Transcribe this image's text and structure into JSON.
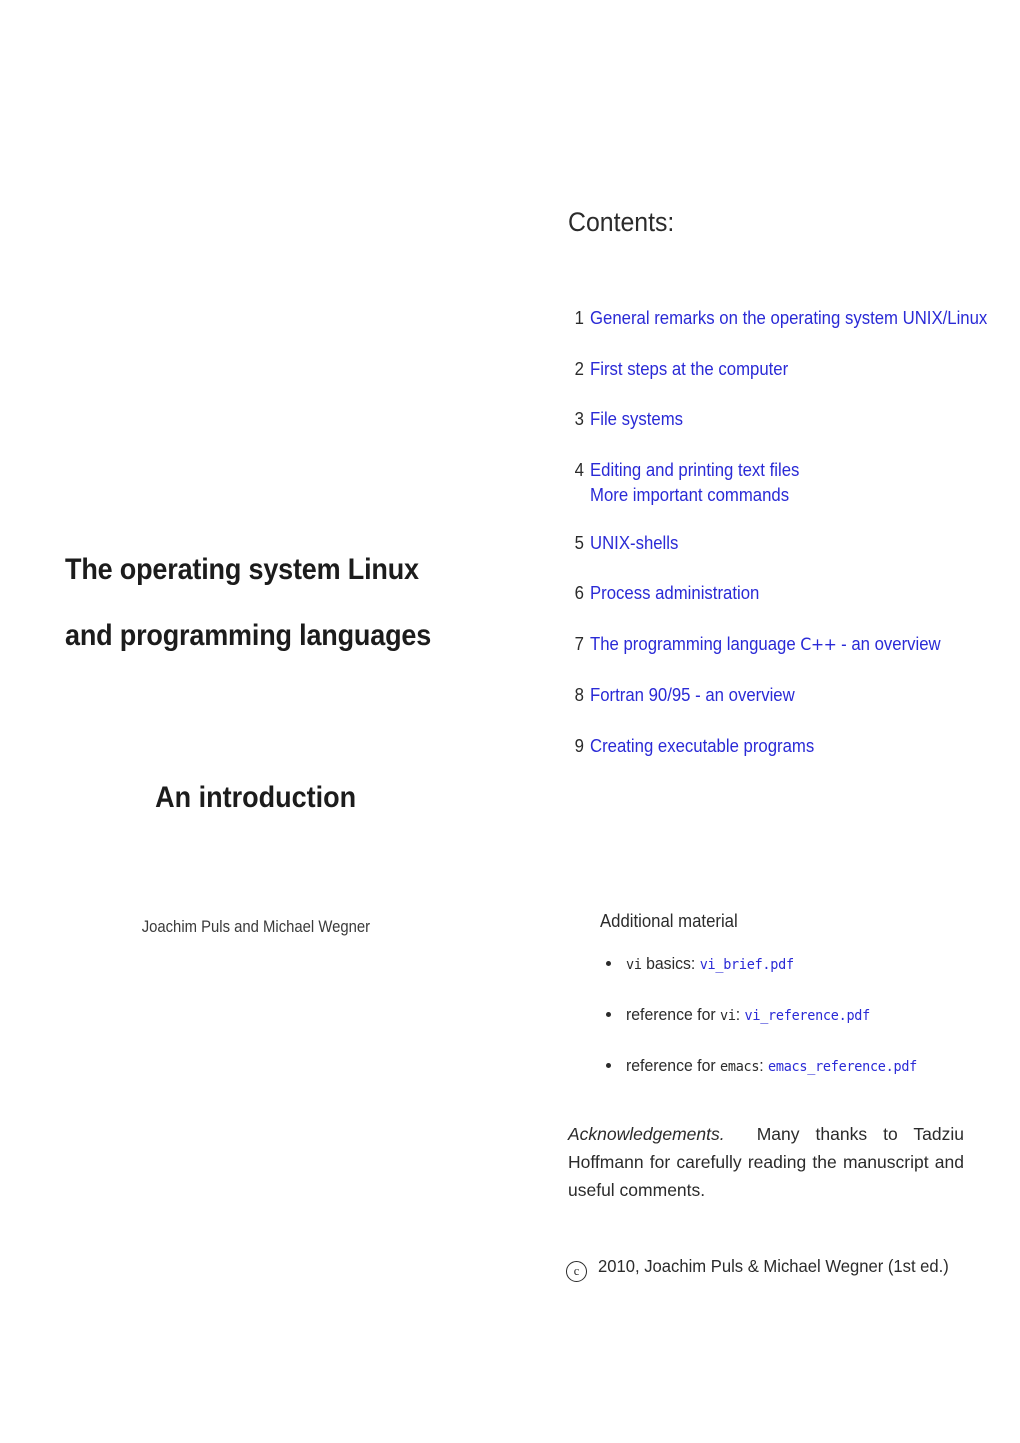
{
  "page": {
    "background": "#ffffff",
    "link_color": "#2a2ad6",
    "text_color": "#2b2b2b"
  },
  "left": {
    "title_line_1": "The operating system Linux",
    "title_line_2": "and programming languages",
    "subtitle": "An introduction",
    "authors": "Joachim Puls and Michael Wegner"
  },
  "right": {
    "contents_heading": "Contents:",
    "toc": [
      {
        "num": "1",
        "title": "General remarks on the operating system UNIX/Linux"
      },
      {
        "num": "2",
        "title": "First steps at the computer"
      },
      {
        "num": "3",
        "title": "File systems"
      },
      {
        "num": "4",
        "title": "Editing and printing text files",
        "sub": "More important commands"
      },
      {
        "num": "5",
        "title": "UNIX-shells"
      },
      {
        "num": "6",
        "title": "Process administration"
      },
      {
        "num": "7",
        "title_pre": "The programming language ",
        "title_code": "C++",
        "title_post": " - an overview"
      },
      {
        "num": "8",
        "title": "Fortran 90/95 - an overview"
      },
      {
        "num": "9",
        "title": "Creating executable programs"
      }
    ],
    "additional": {
      "heading": "Additional material",
      "items": [
        {
          "label_mono": "vi",
          "label_rest": " basics:",
          "file": "vi_brief.pdf"
        },
        {
          "label_pre": "reference for ",
          "label_mono": "vi",
          "label_rest": ":",
          "file": "vi_reference.pdf"
        },
        {
          "label_pre": "reference for ",
          "label_mono": "emacs",
          "label_rest": ":",
          "file": "emacs_reference.pdf"
        }
      ]
    },
    "acknowledgements": {
      "label": "Acknowledgements.",
      "body": "Many thanks to Tadziu Hoffmann for carefully reading the manuscript and useful comments."
    },
    "copyright": {
      "symbol": "c",
      "text": "2010, Joachim Puls & Michael Wegner (1st ed.)"
    }
  }
}
